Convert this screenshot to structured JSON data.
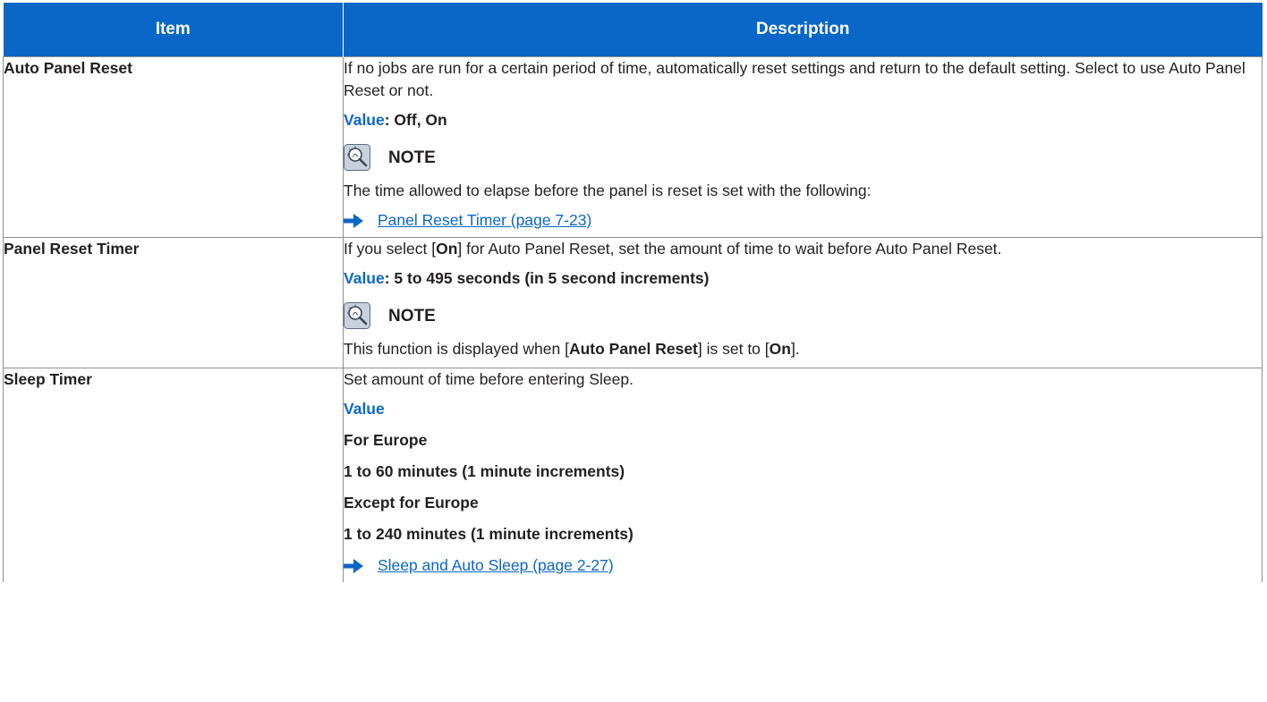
{
  "table": {
    "header_item": "Item",
    "header_description": "Description"
  },
  "rows": [
    {
      "item": "Auto Panel Reset",
      "desc_line1": "If no jobs are run for a certain period of time, automatically reset settings and return to the default setting. Select to use Auto Panel Reset or not.",
      "value_label": "Value",
      "value_text": ": Off, On",
      "note_label": "NOTE",
      "note_text": "The time allowed to elapse before the panel is reset is set with the following:",
      "link": "Panel Reset Timer (page 7-23)"
    },
    {
      "item": "Panel Reset Timer",
      "desc_pre": "If you select [",
      "desc_kw": "On",
      "desc_post": "] for Auto Panel Reset, set the amount of time to wait before Auto Panel Reset.",
      "value_label": "Value",
      "value_text": ": 5 to 495 seconds (in 5 second increments)",
      "note_label": "NOTE",
      "note_pre": "This function is displayed when [",
      "note_kw1": "Auto Panel Reset",
      "note_mid": "] is set to [",
      "note_kw2": "On",
      "note_post": "]."
    },
    {
      "item": "Sleep Timer",
      "desc_line1": "Set amount of time before entering Sleep.",
      "value_label": "Value",
      "region1": "For Europe",
      "range1": "1 to 60 minutes (1 minute increments)",
      "region2": "Except for Europe",
      "range2": "1 to 240 minutes (1 minute increments)",
      "link": "Sleep and Auto Sleep (page 2-27)"
    }
  ],
  "colors": {
    "header_bg": "#0b67c7",
    "accent": "#0b67c7",
    "border": "#8f8f8f",
    "text": "#231f20"
  },
  "icons": {
    "note": "lightbulb-magnifier-icon",
    "link": "right-arrow-icon"
  }
}
